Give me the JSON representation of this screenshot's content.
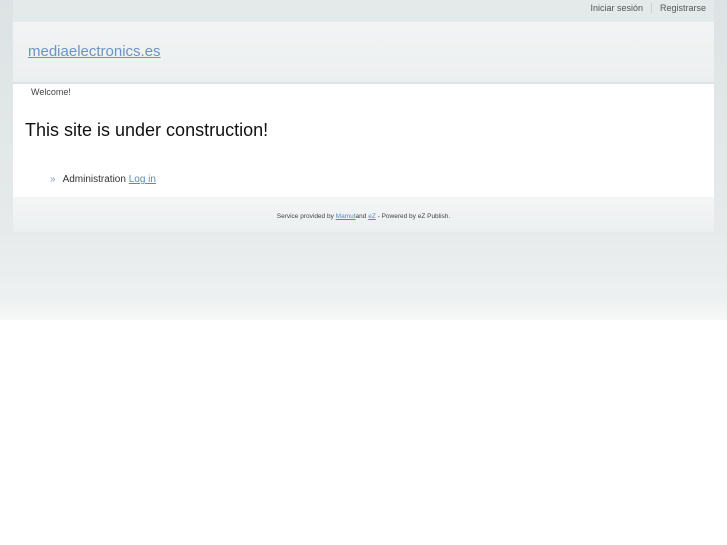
{
  "topbar": {
    "login_label": "Iniciar sesión",
    "register_label": "Registrarse"
  },
  "header": {
    "site_name": "mediaelectronics.es"
  },
  "main": {
    "welcome": "Welcome!",
    "headline": "This site is under construction!",
    "admin": {
      "bullet": "»",
      "label": "Administration",
      "login_link": "Log in"
    }
  },
  "footer": {
    "prefix": "Service provided by",
    "provider_link": "Mamut",
    "and": "and",
    "ez_link": "eZ",
    "suffix": "- Powered by eZ Publish."
  },
  "colors": {
    "link": "#5b88c4",
    "site_name": "#6b93c8",
    "background": "#e4e9ea"
  }
}
